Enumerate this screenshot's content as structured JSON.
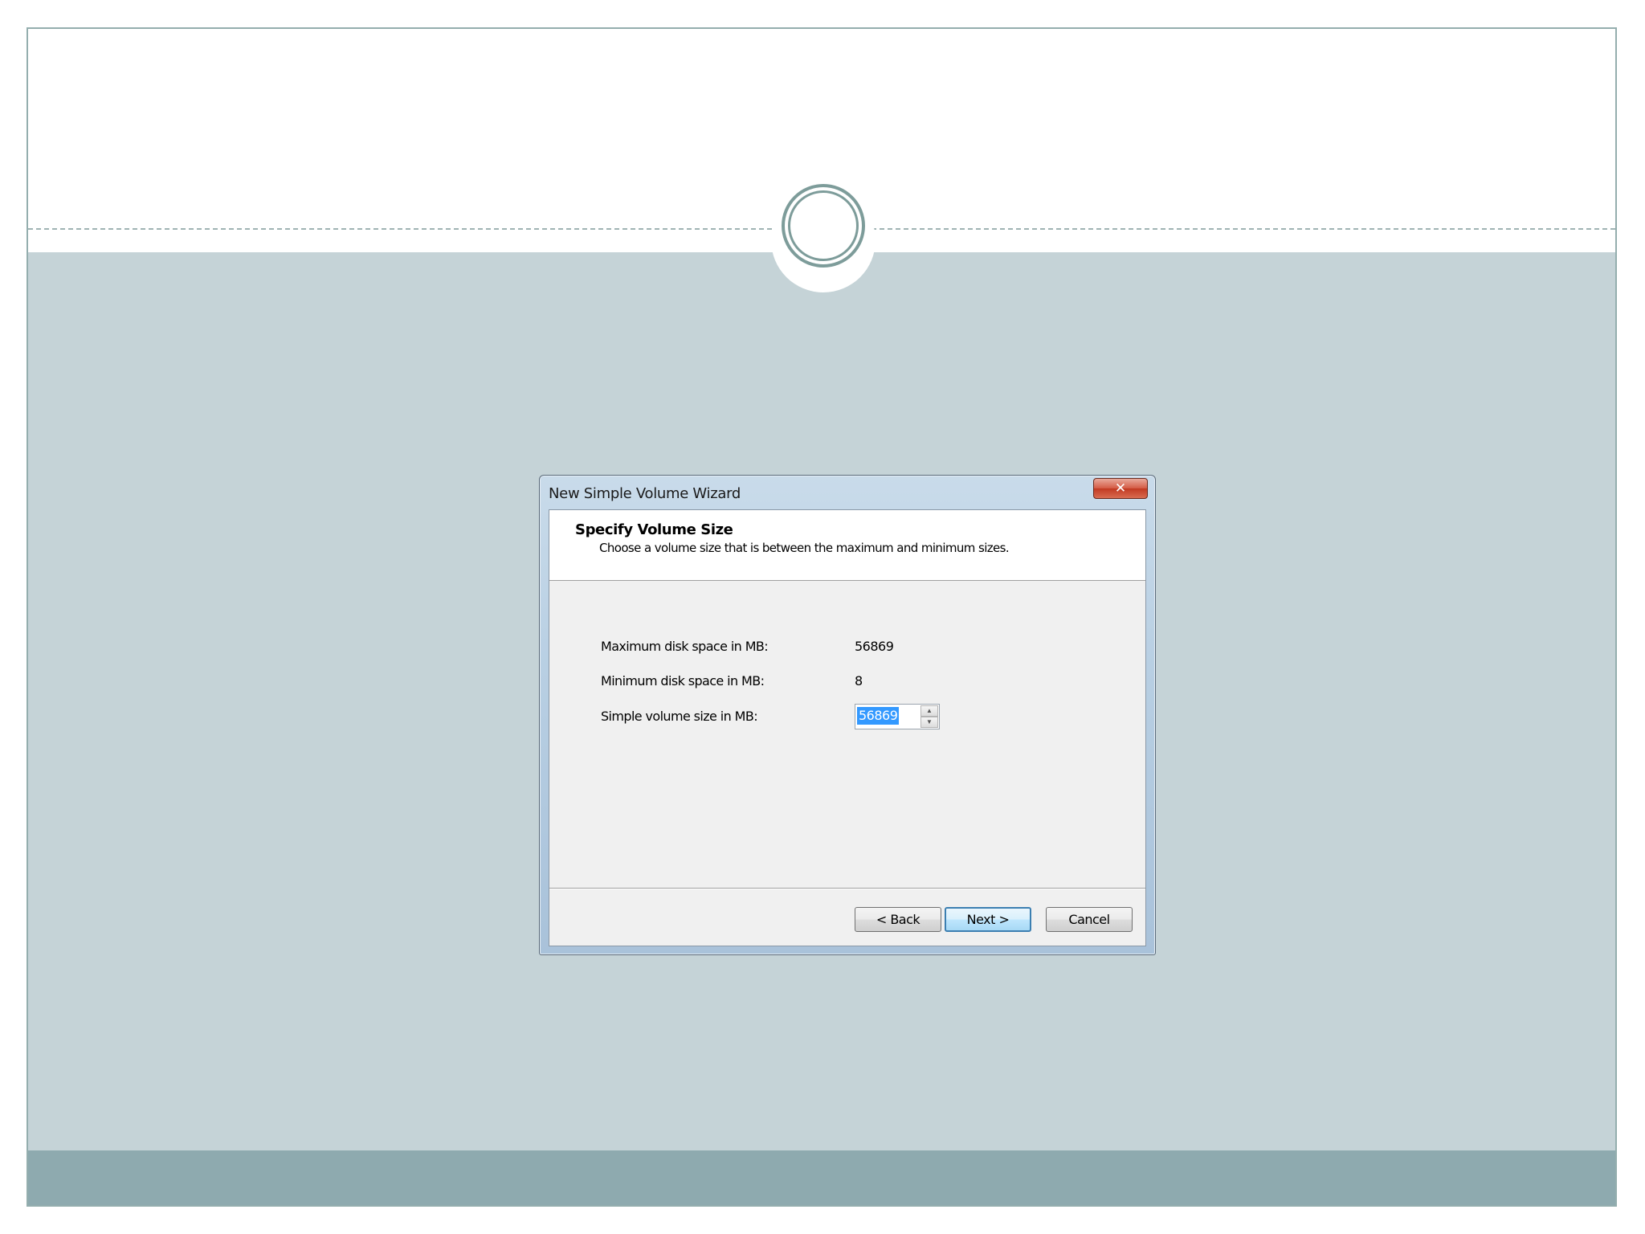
{
  "dialog": {
    "title": "New Simple Volume Wizard",
    "close_glyph": "✕",
    "heading": "Specify Volume Size",
    "subheading": "Choose a volume size that is between the maximum and minimum sizes.",
    "fields": {
      "max_label": "Maximum disk space in MB:",
      "max_value": "56869",
      "min_label": "Minimum disk space in MB:",
      "min_value": "8",
      "size_label": "Simple volume size in MB:",
      "size_value": "56869"
    },
    "buttons": {
      "back": "< Back",
      "next": "Next >",
      "cancel": "Cancel"
    }
  },
  "colors": {
    "slide_body": "#c5d3d7",
    "footer_band": "#8eaaaf",
    "ornament": "#7d9c9a"
  }
}
